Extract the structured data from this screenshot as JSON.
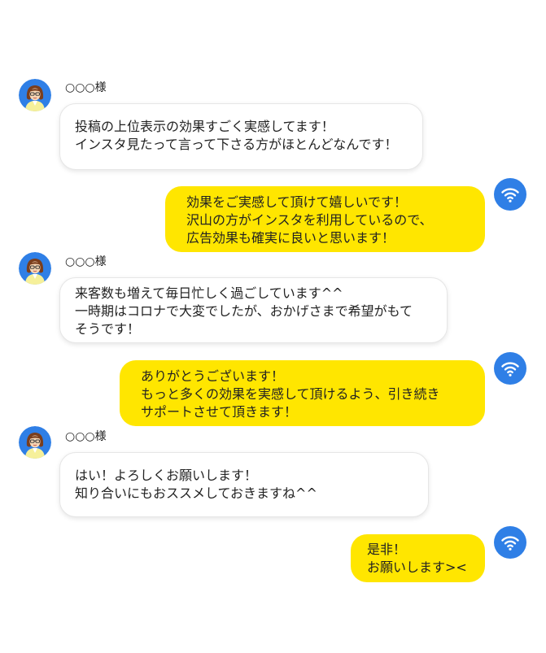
{
  "colors": {
    "outgoing_bubble": "#ffe600",
    "incoming_bubble": "#ffffff",
    "wifi_badge": "#2f7fe6"
  },
  "messages": [
    {
      "direction": "incoming",
      "sender": "○○○様",
      "avatar_icon": "woman-avatar-icon",
      "text": "投稿の上位表示の効果すごく実感してます！\nインスタ見たって言って下さる方がほとんどなんです！"
    },
    {
      "direction": "outgoing",
      "avatar_icon": "wifi-icon",
      "text": "効果をご実感して頂けて嬉しいです！\n沢山の方がインスタを利用しているので、\n広告効果も確実に良いと思います！"
    },
    {
      "direction": "incoming",
      "sender": "○○○様",
      "avatar_icon": "woman-avatar-icon",
      "text": "来客数も増えて毎日忙しく過ごしています^^\n一時期はコロナで大変でしたが、おかげさまで希望がもて\nそうです！"
    },
    {
      "direction": "outgoing",
      "avatar_icon": "wifi-icon",
      "text": "ありがとうございます！\nもっと多くの効果を実感して頂けるよう、引き続き\nサポートさせて頂きます！"
    },
    {
      "direction": "incoming",
      "sender": "○○○様",
      "avatar_icon": "woman-avatar-icon",
      "text": "はい！よろしくお願いします！\n知り合いにもおススメしておきますね^^"
    },
    {
      "direction": "outgoing",
      "avatar_icon": "wifi-icon",
      "text": "是非！\nお願いします><"
    }
  ]
}
